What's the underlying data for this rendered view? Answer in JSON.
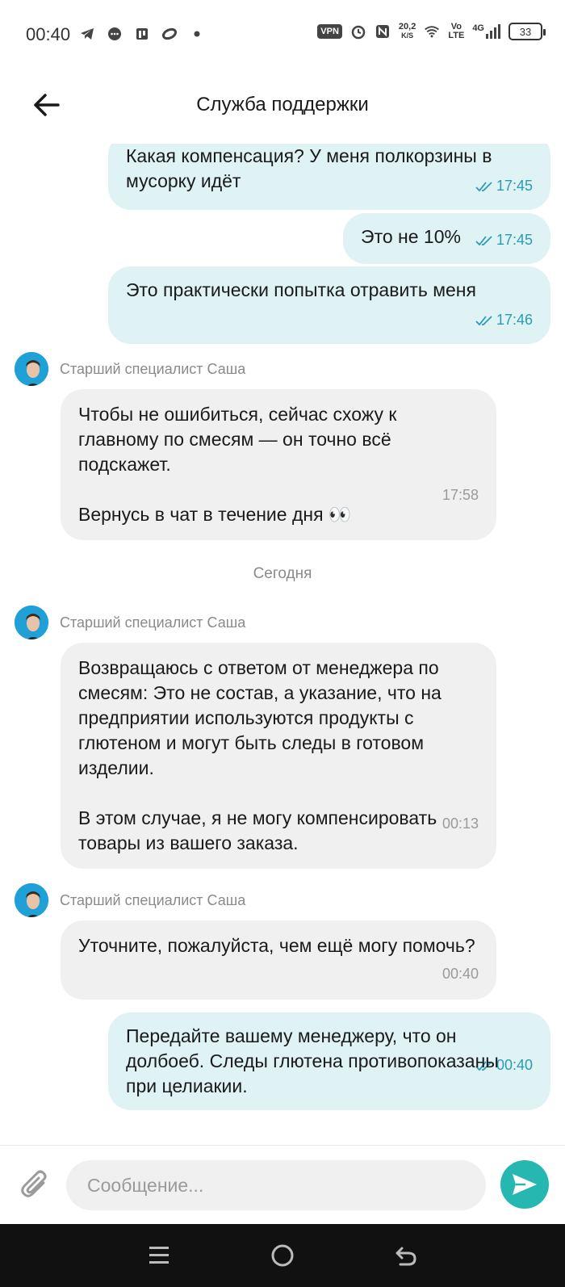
{
  "status_bar": {
    "time": "00:40",
    "network_speed": "20,2",
    "network_speed_unit": "K/S",
    "vpn_label": "VPN",
    "volte_label_top": "Vo",
    "volte_label_bottom": "LTE",
    "signal_label": "4G",
    "battery_level": "33"
  },
  "header": {
    "title": "Служба поддержки"
  },
  "messages": [
    {
      "direction": "out",
      "text": "Какая компенсация? У меня полкорзины в мусорку идёт",
      "time": "17:45"
    },
    {
      "direction": "out",
      "text": "Это не 10%",
      "time": "17:45"
    },
    {
      "direction": "out",
      "text": "Это практически попытка отравить меня",
      "time": "17:46"
    },
    {
      "direction": "in",
      "sender": "Старший специалист Саша",
      "text": "Чтобы не ошибиться, сейчас схожу к главному по смесям — он точно всё подскажет.\n\nВернусь в чат в течение дня 👀",
      "time": "17:58"
    },
    {
      "direction": "in",
      "sender": "Старший специалист Саша",
      "text": "Возвращаюсь с ответом от менеджера по смесям: Это не состав, а указание, что на предприятии используются продукты с глютеном и могут быть следы в готовом изделии.\n\nВ этом случае, я не могу компенсировать товары из вашего заказа.",
      "time": "00:13"
    },
    {
      "direction": "in",
      "sender": "Старший специалист Саша",
      "text": "Уточните, пожалуйста, чем ещё могу помочь?",
      "time": "00:40"
    },
    {
      "direction": "out",
      "text": "Передайте вашему менеджеру, что он долбоеб. Следы глютена противопоказаны при целиакии.",
      "time": "00:40"
    }
  ],
  "date_divider": "Сегодня",
  "composer": {
    "placeholder": "Сообщение..."
  },
  "colors": {
    "outgoing_bubble": "#dff3f5",
    "incoming_bubble": "#f0f0f0",
    "accent": "#26b7b0",
    "read_check": "#2a9bb5"
  }
}
